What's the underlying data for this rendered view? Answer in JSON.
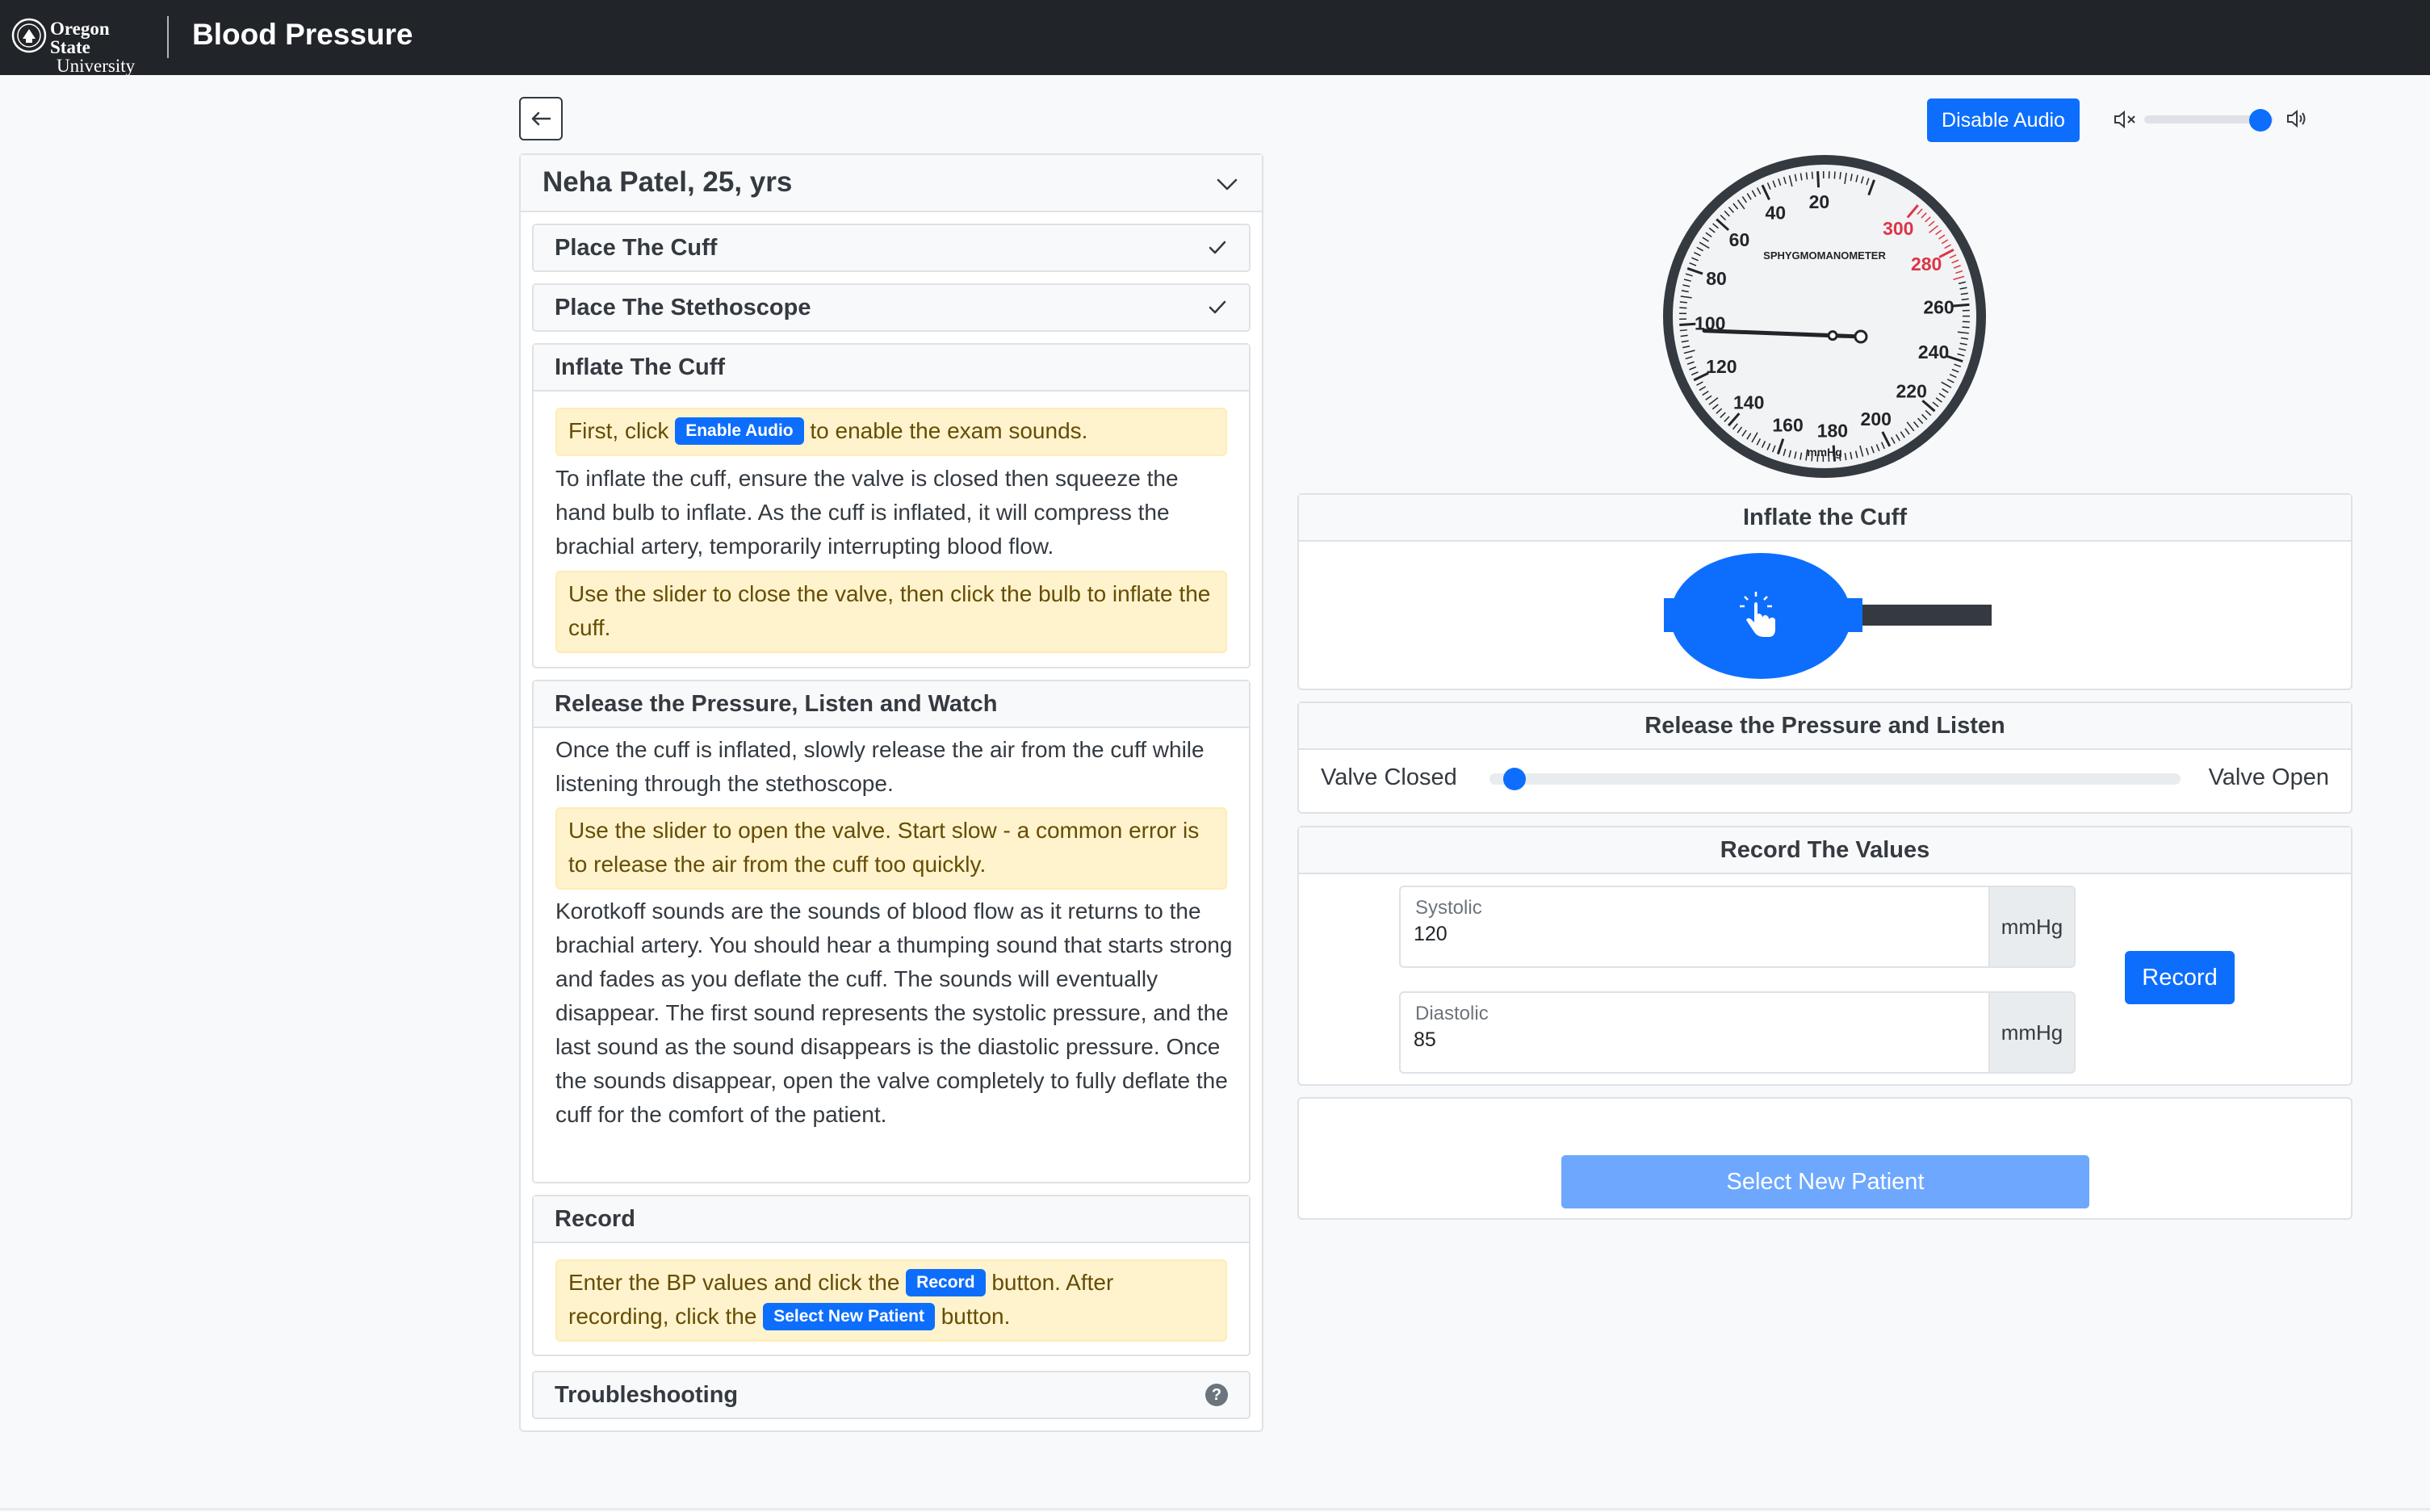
{
  "header": {
    "logo_line1": "Oregon State",
    "logo_line2": "University",
    "title": "Blood Pressure"
  },
  "patient": {
    "name": "Neha Patel, 25, yrs"
  },
  "steps": {
    "cuff": {
      "title": "Place The Cuff",
      "completed": true
    },
    "stethoscope": {
      "title": "Place The Stethoscope",
      "completed": true
    },
    "inflate": {
      "title": "Inflate The Cuff",
      "note_before": "First, click",
      "note_chip": "Enable Audio",
      "note_after": "to enable the exam sounds.",
      "body": "To inflate the cuff, ensure the valve is closed then squeeze the hand bulb to inflate. As the cuff is inflated, it will compress the brachial artery, temporarily interrupting blood flow.",
      "note2": "Use the slider to close the valve, then click the bulb to inflate the cuff."
    },
    "release": {
      "title": "Release the Pressure, Listen and Watch",
      "body1": "Once the cuff is inflated, slowly release the air from the cuff while listening through the stethoscope.",
      "note": "Use the slider to open the valve. Start slow - a common error is to release the air from the cuff too quickly.",
      "body2": "Korotkoff sounds are the sounds of blood flow as it returns to the brachial artery. You should hear a thumping sound that starts strong and fades as you deflate the cuff. The sounds will eventually disappear. The first sound represents the systolic pressure, and the last sound as the sound disappears is the diastolic pressure. Once the sounds disappear, open the valve completely to fully deflate the cuff for the comfort of the patient."
    },
    "record": {
      "title": "Record",
      "text1": "Enter the BP values and click the",
      "chip1": "Record",
      "text2": "button. After recording, click the",
      "chip2": "Select New Patient",
      "text3": "button."
    },
    "troubleshooting": {
      "title": "Troubleshooting",
      "help_glyph": "?"
    }
  },
  "audio": {
    "button_label": "Disable Audio",
    "volume_fraction": 0.9
  },
  "gauge": {
    "label": "SPHYGMOMANOMETER",
    "unit": "mmHg",
    "ticks": [
      "20",
      "40",
      "60",
      "80",
      "100",
      "120",
      "140",
      "160",
      "180",
      "200",
      "220",
      "240",
      "260",
      "280",
      "300"
    ],
    "red_ticks": [
      "280",
      "300"
    ],
    "needle_value_mmHg": 103,
    "max_mmHg": 300
  },
  "inflate_panel": {
    "title": "Inflate the Cuff",
    "bulb_color": "#0d6efd"
  },
  "release_panel": {
    "title": "Release the Pressure and Listen",
    "left_label": "Valve Closed",
    "right_label": "Valve Open",
    "valve_fraction": 0.02
  },
  "record_panel": {
    "title": "Record The Values",
    "systolic_label": "Systolic",
    "systolic_value": "120",
    "diastolic_label": "Diastolic",
    "diastolic_value": "85",
    "unit": "mmHg",
    "record_label": "Record"
  },
  "new_patient": {
    "label": "Select New Patient"
  },
  "colors": {
    "primary": "#0d6efd",
    "primary_light": "#6ea8fe",
    "navbar": "#212529",
    "note_bg": "#fff3cd",
    "gauge_red": "#dc3545"
  }
}
